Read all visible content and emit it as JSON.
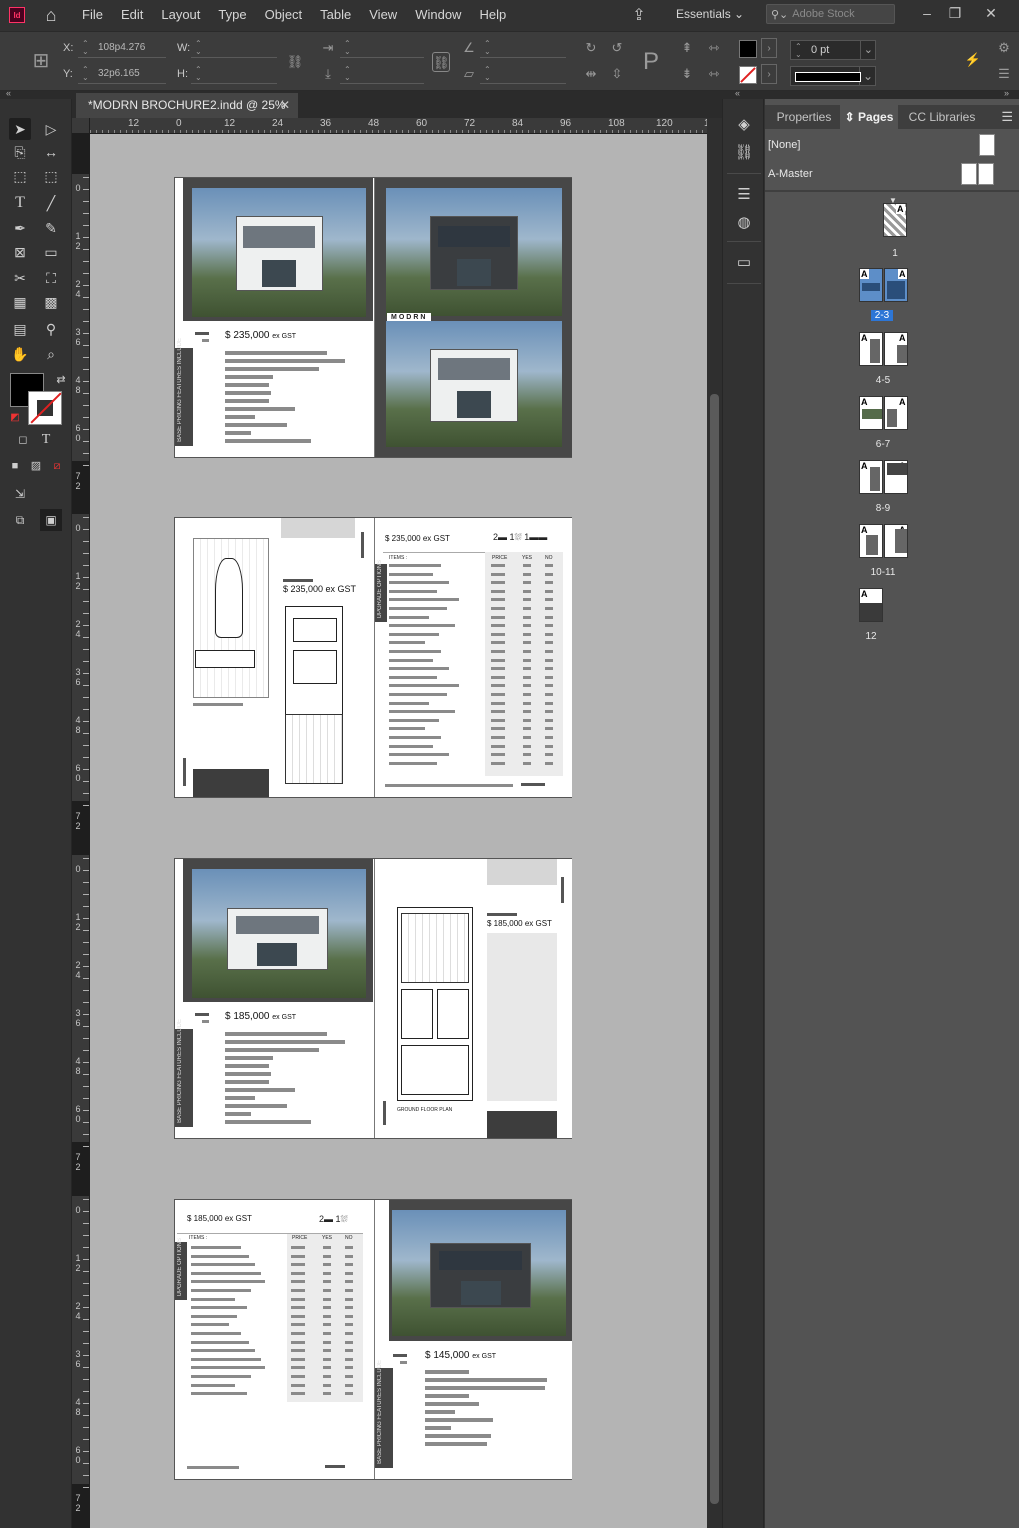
{
  "app": {
    "logo_text": "Id",
    "menus": [
      "File",
      "Edit",
      "Layout",
      "Type",
      "Object",
      "Table",
      "View",
      "Window",
      "Help"
    ],
    "workspace": "Essentials",
    "search_placeholder": "Adobe Stock"
  },
  "control": {
    "x_label": "X:",
    "y_label": "Y:",
    "w_label": "W:",
    "h_label": "H:",
    "x_value": "108p4.276",
    "y_value": "32p6.165",
    "w_value": "",
    "h_value": "",
    "stroke_weight": "0 pt",
    "fill_color": "#000000",
    "stroke_color": "#ffffff"
  },
  "document": {
    "tab_title": "*MODRN BROCHURE2.indd @ 25%"
  },
  "ruler": {
    "h_labels": [
      "12",
      "0",
      "12",
      "24",
      "36",
      "48",
      "60",
      "72",
      "84",
      "96",
      "108",
      "120",
      "1"
    ],
    "v_labels": [
      "0",
      "1 2",
      "2 4",
      "3 6",
      "4 8",
      "6 0",
      "7 2"
    ]
  },
  "spreads": [
    {
      "price_left": "$ 235,000",
      "gst": "ex GST",
      "side_text": "BASE PRICING FEATURES INCLUDE",
      "logo": "MODRN"
    },
    {
      "price_left": "$ 235,000 ex GST",
      "price_right": "$ 235,000 ex GST",
      "items_label": "ITEMS :",
      "col_price": "PRICE",
      "col_yes": "YES",
      "col_no": "NO",
      "side_text": "UPGRADE OPTIONS"
    },
    {
      "price_left": "$ 185,000",
      "gst": "ex GST",
      "price_right": "$ 185,000 ex GST",
      "side_text": "BASE PRICING FEATURES INCLUDE",
      "plan_label": "GROUND FLOOR PLAN"
    },
    {
      "price_left": "$ 185,000 ex GST",
      "items_label": "ITEMS :",
      "col_price": "PRICE",
      "col_yes": "YES",
      "col_no": "NO",
      "side_text_left": "UPGRADE OPTIONS",
      "price_right": "$ 145,000",
      "gst": "ex GST",
      "side_text": "BASE PRICING FEATURES INCLUDE"
    }
  ],
  "panel": {
    "tabs": [
      "Properties",
      "Pages",
      "CC Libraries"
    ],
    "active_tab": "Pages",
    "masters": [
      "[None]",
      "A-Master"
    ],
    "pages": [
      {
        "label": "1",
        "selected": false
      },
      {
        "label": "2-3",
        "selected": true
      },
      {
        "label": "4-5",
        "selected": false
      },
      {
        "label": "6-7",
        "selected": false
      },
      {
        "label": "8-9",
        "selected": false
      },
      {
        "label": "10-11",
        "selected": false
      },
      {
        "label": "12",
        "selected": false
      }
    ],
    "master_prefix": "A"
  }
}
